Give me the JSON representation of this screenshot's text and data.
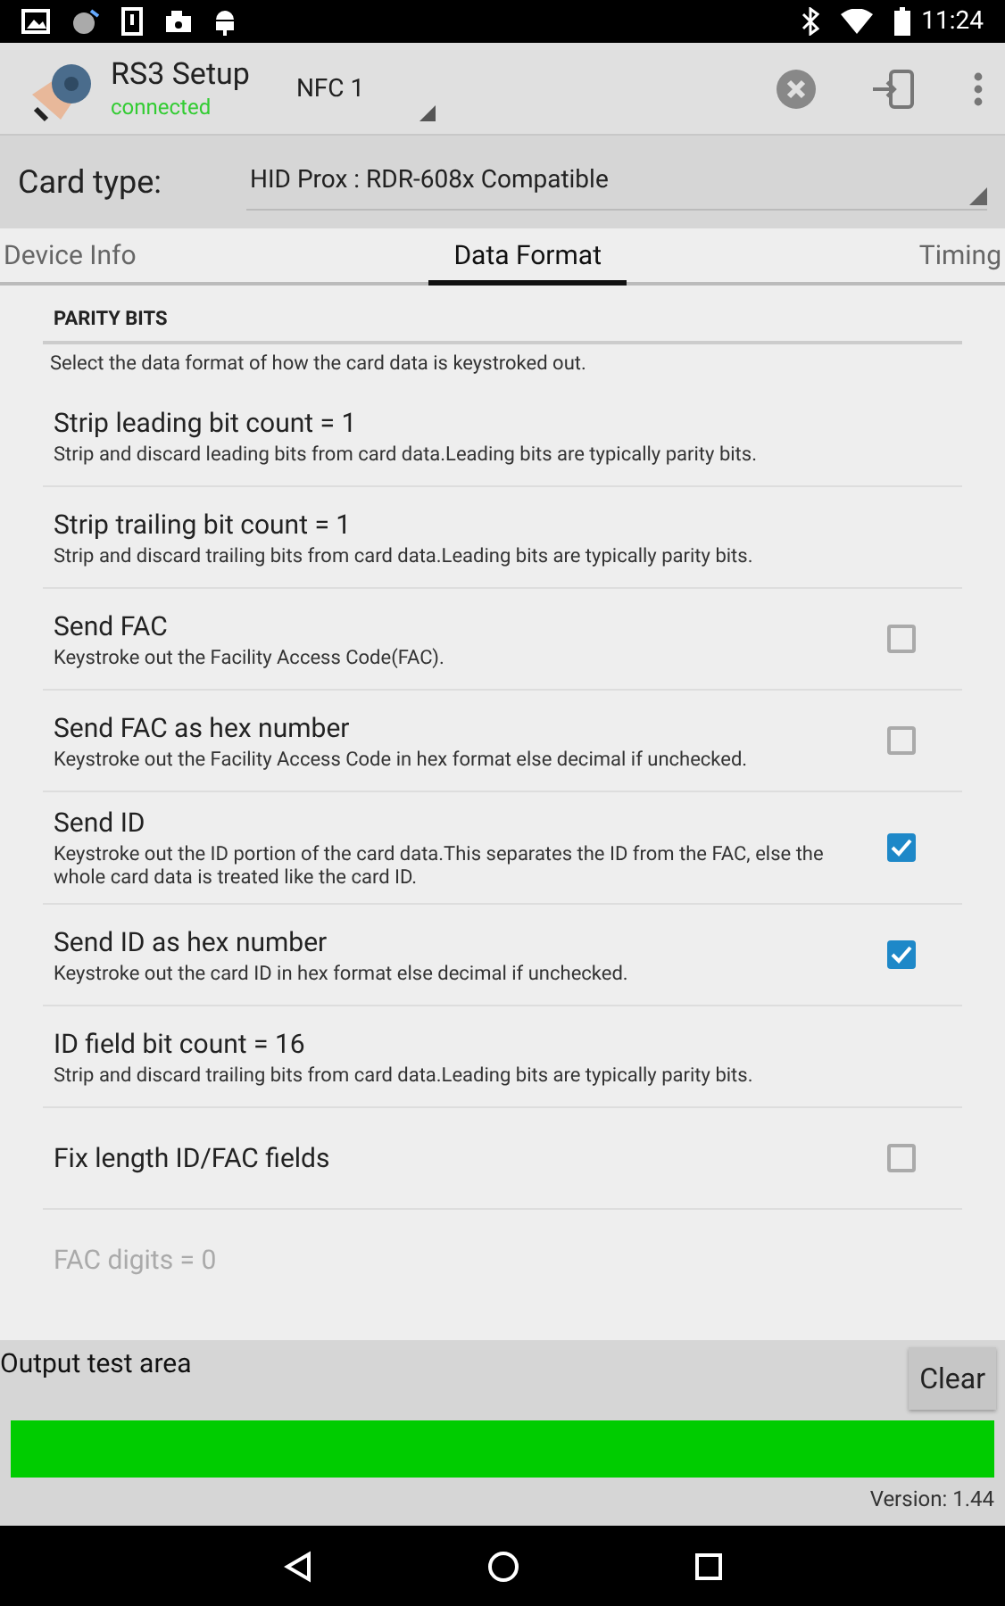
{
  "status_bar": {
    "time": "11:24"
  },
  "app_bar": {
    "title": "RS3 Setup",
    "status": "connected",
    "device": "NFC 1"
  },
  "card_type": {
    "label": "Card type:",
    "value": "HID Prox : RDR-608x Compatible"
  },
  "tabs": [
    {
      "label": "Device Info",
      "selected": false
    },
    {
      "label": "Data Format",
      "selected": true
    },
    {
      "label": "Timing",
      "selected": false
    }
  ],
  "section": {
    "title": "PARITY BITS",
    "description": "Select the data format of how the card data is keystroked out."
  },
  "settings": [
    {
      "kind": "value",
      "title": "Strip leading bit count = 1",
      "summary": "Strip and discard leading bits from card data.Leading bits are typically parity bits."
    },
    {
      "kind": "value",
      "title": "Strip trailing bit count = 1",
      "summary": "Strip and discard trailing bits from card data.Leading bits are typically parity bits."
    },
    {
      "kind": "check",
      "title": "Send FAC",
      "summary": "Keystroke out the Facility Access Code(FAC).",
      "checked": false
    },
    {
      "kind": "check",
      "title": "Send FAC as hex number",
      "summary": "Keystroke out the Facility Access Code in hex format else decimal if unchecked.",
      "checked": false
    },
    {
      "kind": "check",
      "title": "Send ID",
      "summary": "Keystroke out the ID portion of the card data.This separates the ID from the FAC, else the whole card data is treated like the card ID.",
      "checked": true
    },
    {
      "kind": "check",
      "title": "Send ID as hex number",
      "summary": "Keystroke out the card ID in hex format else decimal if unchecked.",
      "checked": true
    },
    {
      "kind": "value",
      "title": "ID field bit count = 16",
      "summary": "Strip and discard trailing bits from card data.Leading bits are typically parity bits."
    },
    {
      "kind": "check",
      "title": "Fix length ID/FAC fields",
      "checked": false
    },
    {
      "kind": "value",
      "title": "FAC digits = 0",
      "disabled": true
    }
  ],
  "output": {
    "label": "Output test area",
    "button": "Clear",
    "version": "Version: 1.44"
  }
}
